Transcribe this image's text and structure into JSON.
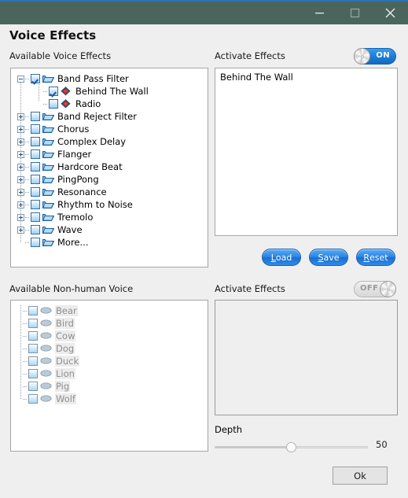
{
  "window": {
    "minimize_icon": "minimize-icon",
    "maximize_icon": "maximize-icon",
    "close_icon": "close-icon"
  },
  "page": {
    "title": "Voice Effects"
  },
  "left": {
    "effects_label": "Available Voice Effects",
    "nonhuman_label": "Available Non-human Voice",
    "tree": [
      {
        "label": "Band Pass Filter",
        "level": 0,
        "expander": "minus",
        "checked": true,
        "icon": "folder-icon",
        "disabled": false
      },
      {
        "label": "Behind The Wall",
        "level": 1,
        "expander": "none",
        "checked": true,
        "icon": "effect-icon",
        "disabled": false
      },
      {
        "label": "Radio",
        "level": 1,
        "expander": "none",
        "checked": false,
        "icon": "effect-icon",
        "disabled": false
      },
      {
        "label": "Band Reject Filter",
        "level": 0,
        "expander": "plus",
        "checked": false,
        "icon": "folder-icon",
        "disabled": false
      },
      {
        "label": "Chorus",
        "level": 0,
        "expander": "plus",
        "checked": false,
        "icon": "folder-icon",
        "disabled": false
      },
      {
        "label": "Complex Delay",
        "level": 0,
        "expander": "plus",
        "checked": false,
        "icon": "folder-icon",
        "disabled": false
      },
      {
        "label": "Flanger",
        "level": 0,
        "expander": "plus",
        "checked": false,
        "icon": "folder-icon",
        "disabled": false
      },
      {
        "label": "Hardcore Beat",
        "level": 0,
        "expander": "plus",
        "checked": false,
        "icon": "folder-icon",
        "disabled": false
      },
      {
        "label": "PingPong",
        "level": 0,
        "expander": "plus",
        "checked": false,
        "icon": "folder-icon",
        "disabled": false
      },
      {
        "label": "Resonance",
        "level": 0,
        "expander": "plus",
        "checked": false,
        "icon": "folder-icon",
        "disabled": false
      },
      {
        "label": "Rhythm to Noise",
        "level": 0,
        "expander": "plus",
        "checked": false,
        "icon": "folder-icon",
        "disabled": false
      },
      {
        "label": "Tremolo",
        "level": 0,
        "expander": "plus",
        "checked": false,
        "icon": "folder-icon",
        "disabled": false
      },
      {
        "label": "Wave",
        "level": 0,
        "expander": "plus",
        "checked": false,
        "icon": "folder-icon",
        "disabled": false
      },
      {
        "label": "More...",
        "level": 0,
        "expander": "none",
        "checked": false,
        "icon": "folder-icon",
        "disabled": false
      }
    ],
    "nonhuman": [
      {
        "label": "Bear",
        "checked": false,
        "icon": "voice-icon",
        "disabled": true
      },
      {
        "label": "Bird",
        "checked": false,
        "icon": "voice-icon",
        "disabled": true
      },
      {
        "label": "Cow",
        "checked": false,
        "icon": "voice-icon",
        "disabled": true
      },
      {
        "label": "Dog",
        "checked": false,
        "icon": "voice-icon",
        "disabled": true
      },
      {
        "label": "Duck",
        "checked": false,
        "icon": "voice-icon",
        "disabled": true
      },
      {
        "label": "Lion",
        "checked": false,
        "icon": "voice-icon",
        "disabled": true
      },
      {
        "label": "Pig",
        "checked": false,
        "icon": "voice-icon",
        "disabled": true
      },
      {
        "label": "Wolf",
        "checked": false,
        "icon": "voice-icon",
        "disabled": true
      }
    ]
  },
  "right": {
    "effects_label": "Activate Effects",
    "nonhuman_label": "Activate Effects",
    "toggle_effects": {
      "state": "ON",
      "enabled": true
    },
    "toggle_nonhuman": {
      "state": "OFF",
      "enabled": false
    },
    "active_effects": [
      "Behind The Wall"
    ],
    "active_nonhuman": [],
    "buttons": {
      "load": {
        "accel": "L",
        "rest": "oad"
      },
      "save": {
        "accel": "S",
        "rest": "ave"
      },
      "reset": {
        "accel": "R",
        "rest": "eset"
      }
    },
    "depth": {
      "label": "Depth",
      "value": 50,
      "min": 0,
      "max": 100
    }
  },
  "footer": {
    "ok_label": "Ok"
  },
  "colors": {
    "titlebar": "#4a665c",
    "accent_top": "#2a72b5",
    "toggle_on": "#1a7ed8",
    "button_blue": "#2b86e4",
    "body_bg": "#efefef"
  }
}
